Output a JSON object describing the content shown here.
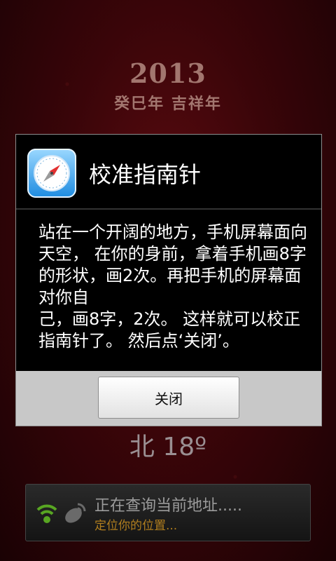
{
  "background": {
    "year": "2013",
    "year_subtitle": "癸巳年  吉祥年"
  },
  "compass": {
    "heading": "北 18º"
  },
  "dialog": {
    "title": "校准指南针",
    "icon": "compass-app-icon",
    "message": "站在一个开阔的地方，手机屏幕面向天空， 在你的身前，拿着手机画8字的形状，画2次。再把手机的屏幕面对你自\n己，画8字，2次。 这样就可以校正指南针了。 然后点‘关闭’。",
    "close_label": "关闭"
  },
  "location_status": {
    "main": "正在查询当前地址.....",
    "sub": "定位你的位置...",
    "icons": [
      "wifi-icon",
      "satellite-icon"
    ],
    "sub_color": "#b07e1e"
  }
}
